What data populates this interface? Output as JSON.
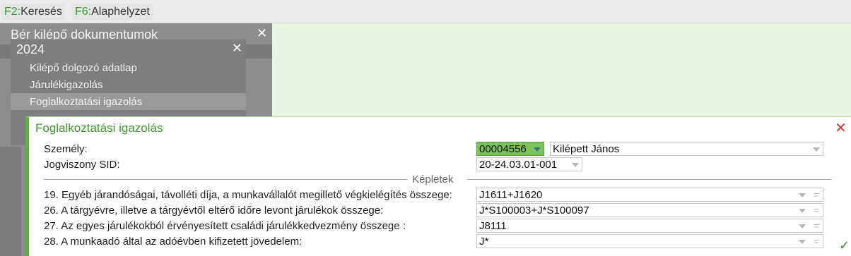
{
  "topbar": {
    "f2_key": "F2:",
    "f2_label": "Keresés",
    "f6_key": "F6:",
    "f6_label": "Alaphelyzet"
  },
  "left_panel": {
    "title": "Bér kilépő dokumentumok",
    "close": "✕"
  },
  "year_menu": {
    "year": "2024",
    "close": "✕",
    "items": [
      {
        "label": "Kilépő dolgozó adatlap"
      },
      {
        "label": "Járulékigazolás"
      },
      {
        "label": "Foglalkoztatási igazolás"
      }
    ]
  },
  "dialog": {
    "title": "Foglalkoztatási igazolás",
    "close": "✕",
    "szemely_label": "Személy:",
    "szemely_code": "00004556",
    "szemely_name": "Kilépett János",
    "jogviszony_label": "Jogviszony SID:",
    "jogviszony_value": "20-24.03.01-001",
    "section_label": "Képletek",
    "rows": [
      {
        "label": "19. Egyéb járandóságai, távolléti díja, a munkavállalót megillető végkielégítés összege:",
        "value": "J1611+J1620"
      },
      {
        "label": "26. A tárgyévre, illetve a tárgyévtől eltérő időre levont járulékok összege:",
        "value": "J*S100003+J*S100097"
      },
      {
        "label": "27. Az egyes járulékokból érvényesített családi járulékkedvezmény összege :",
        "value": "J8111"
      },
      {
        "label": "28. A munkaadó által az adóévben kifizetett jövedelem:",
        "value": "J*"
      }
    ],
    "eq_symbol": "=",
    "confirm_icon": "✓"
  },
  "colors": {
    "accent": "#3c9a2a",
    "dialog_border": "#5fb03c",
    "selected_code_bg": "#7cc35a",
    "close_red": "#d03a3a",
    "background": "#e8f3e1"
  }
}
